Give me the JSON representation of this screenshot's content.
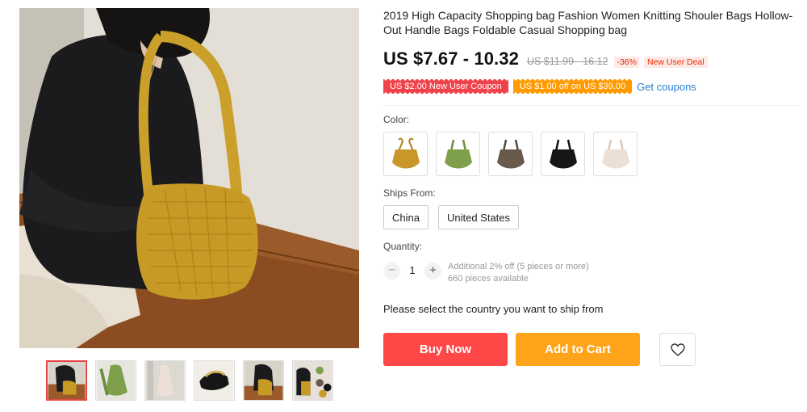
{
  "product": {
    "title": "2019 High Capacity Shopping bag Fashion Women Knitting Shouler Bags Hollow-Out Handle Bags Foldable Casual Shopping bag",
    "price": "US $7.67 - 10.32",
    "original_price": "US $11.99 - 16.12",
    "discount": "-36%",
    "deal_badge": "New User Deal"
  },
  "coupons": {
    "new_user": "US $2.00 New User Coupon",
    "store": "US $1.00 off on US $39.00",
    "get_link": "Get coupons"
  },
  "color": {
    "label": "Color:",
    "options": [
      {
        "icon": "bag-mustard-icon",
        "color": "#c9962a"
      },
      {
        "icon": "bag-green-icon",
        "color": "#7ea04a"
      },
      {
        "icon": "bag-brown-icon",
        "color": "#6a5a4c"
      },
      {
        "icon": "bag-black-icon",
        "color": "#161616"
      },
      {
        "icon": "bag-cream-icon",
        "color": "#ecdfd6"
      }
    ]
  },
  "ships_from": {
    "label": "Ships From:",
    "options": [
      "China",
      "United States"
    ]
  },
  "quantity": {
    "label": "Quantity:",
    "value": "1",
    "minus": "−",
    "plus": "+",
    "discount_note": "Additional 2% off (5 pieces or more)",
    "available": "660 pieces available"
  },
  "ship_prompt": "Please select the country you want to ship from",
  "actions": {
    "buy_now": "Buy Now",
    "add_to_cart": "Add to Cart",
    "wishlist_icon": "heart-icon"
  },
  "gallery": {
    "main_image": "woman-wearing-mustard-knit-bag",
    "selected_thumbnail": 1,
    "thumbnails": [
      "thumb-mustard-worn",
      "thumb-green-bag",
      "thumb-cream-bag",
      "thumb-black-bag-flat",
      "thumb-mustard-worn-2",
      "thumb-color-variants"
    ]
  },
  "colors": {
    "price_red": "#ff4747",
    "coupon_red": "#f0424a",
    "coupon_orange": "#ff9a00",
    "cart_orange": "#ffa31a",
    "link_blue": "#2b7fd3"
  }
}
